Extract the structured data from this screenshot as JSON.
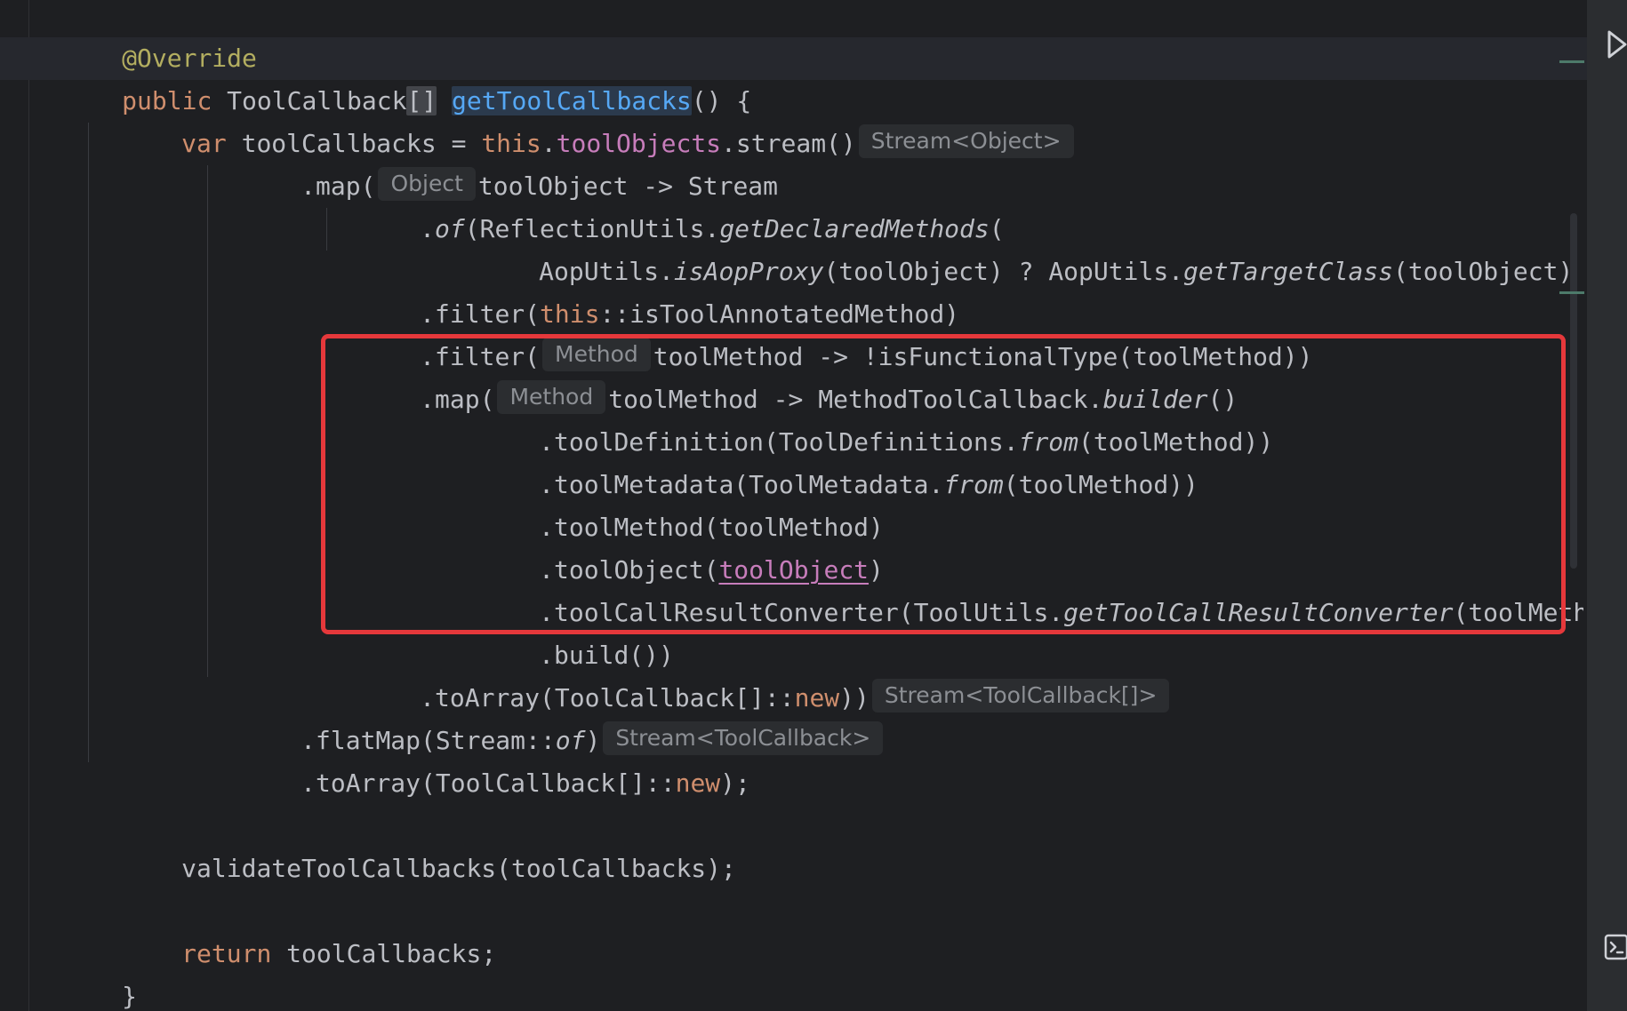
{
  "editor": {
    "lines": {
      "l0": {
        "a": "@Override"
      },
      "l1": {
        "a": "public",
        "b": " ToolCallback",
        "c": "[]",
        "d": " ",
        "e": "getToolCallbacks",
        "f": "() {"
      },
      "l2": {
        "a": "var",
        "b": " toolCallbacks = ",
        "c": "this",
        "d": ".",
        "e": "toolObjects",
        "f": ".stream()",
        "hint": "Stream<Object>"
      },
      "l3": {
        "a": ".map(",
        "hint": "Object",
        "b": "toolObject -> Stream"
      },
      "l4": {
        "a": ".",
        "b": "of",
        "c": "(ReflectionUtils.",
        "d": "getDeclaredMethods",
        "e": "("
      },
      "l5": {
        "a": "AopUtils.",
        "b": "isAopProxy",
        "c": "(toolObject) ? AopUtils.",
        "d": "getTargetClass",
        "e": "(toolObject) : toolObject.getClass()))"
      },
      "l6": {
        "a": ".filter(",
        "b": "this",
        "c": "::isToolAnnotatedMethod)"
      },
      "l7": {
        "a": ".filter(",
        "hint": "Method",
        "b": "toolMethod -> !isFunctionalType(toolMethod))"
      },
      "l8": {
        "a": ".map(",
        "hint": "Method",
        "b": "toolMethod -> MethodToolCallback.",
        "c": "builder",
        "d": "()"
      },
      "l9": {
        "a": ".toolDefinition(ToolDefinitions.",
        "b": "from",
        "c": "(toolMethod))"
      },
      "l10": {
        "a": ".toolMetadata(ToolMetadata.",
        "b": "from",
        "c": "(toolMethod))"
      },
      "l11": {
        "a": ".toolMethod(toolMethod)"
      },
      "l12": {
        "a": ".toolObject(",
        "b": "toolObject",
        "c": ")"
      },
      "l13": {
        "a": ".toolCallResultConverter(ToolUtils.",
        "b": "getToolCallResultConverter",
        "c": "(toolMethod))"
      },
      "l14": {
        "a": ".build())"
      },
      "l15": {
        "a": ".toArray(ToolCallback[]::",
        "b": "new",
        "c": "))",
        "hint": "Stream<ToolCallback[]>"
      },
      "l16": {
        "a": ".flatMap(Stream::",
        "b": "of",
        "c": ")",
        "hint": "Stream<ToolCallback>"
      },
      "l17": {
        "a": ".toArray(ToolCallback[]::",
        "b": "new",
        "c": ");"
      },
      "l19": {
        "a": "validateToolCallbacks(toolCallbacks);"
      },
      "l21": {
        "a": "return",
        "b": " toolCallbacks;"
      },
      "l22": {
        "a": "}"
      }
    }
  },
  "gutter_icons": {
    "run": "run-icon",
    "terminal": "terminal-icon"
  },
  "colors": {
    "background": "#1e1f22",
    "keyword": "#cf8e6d",
    "annotation": "#b3ae60",
    "method_declaration": "#56a8f5",
    "field": "#c77dbb",
    "highlight_box": "#e5383b"
  }
}
